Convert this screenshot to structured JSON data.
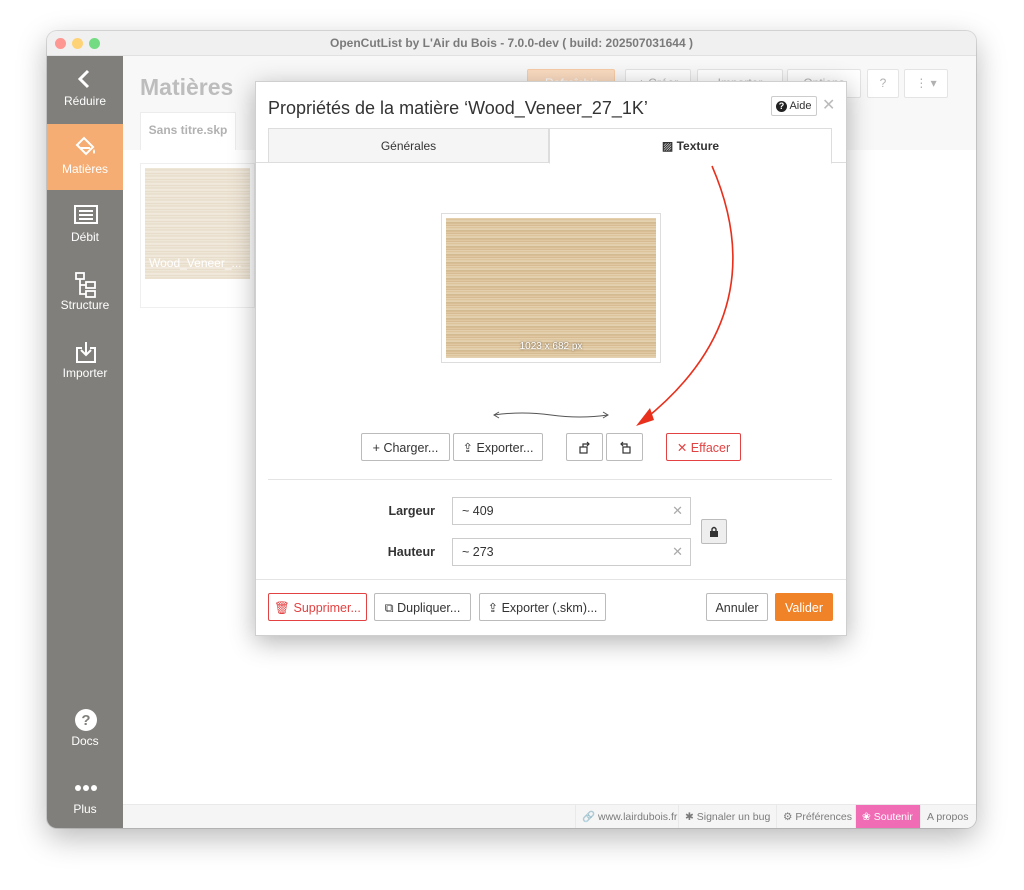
{
  "window": {
    "title": "OpenCutList by L'Air du Bois - 7.0.0-dev ( build: 202507031644 )"
  },
  "sidebar": {
    "items": [
      {
        "label": "Réduire",
        "icon": "chevron-left-icon"
      },
      {
        "label": "Matières",
        "icon": "paint-bucket-icon",
        "active": true
      },
      {
        "label": "Débit",
        "icon": "list-icon"
      },
      {
        "label": "Structure",
        "icon": "tree-icon"
      },
      {
        "label": "Importer",
        "icon": "import-icon"
      }
    ],
    "bottom": [
      {
        "label": "Docs",
        "icon": "question-circle-icon"
      },
      {
        "label": "Plus",
        "icon": "more-dots-icon"
      }
    ]
  },
  "header": {
    "title": "Matières",
    "refresh_label": "Rafraîchir",
    "create_label": "+ Créer",
    "import_label": "Importer",
    "options_label": "Options"
  },
  "file_tab": {
    "label": "Sans titre.skp"
  },
  "card": {
    "name": "Wood_Veneer_..."
  },
  "statusbar": {
    "website": "www.lairdubois.fr",
    "bug": "Signaler un bug",
    "prefs": "Préférences",
    "support": "Soutenir",
    "about": "A propos"
  },
  "modal": {
    "title": "Propriétés de la matière ‘Wood_Veneer_27_1K’",
    "help_label": "Aide",
    "tabs": [
      {
        "label": "Générales",
        "active": false
      },
      {
        "label": "Texture",
        "active": true
      }
    ],
    "texture_size": "1023 x 682 px",
    "buttons": {
      "load": "Charger...",
      "export": "Exporter...",
      "clear": "Effacer"
    },
    "fields": {
      "width_label": "Largeur",
      "width_value": "~ 409",
      "height_label": "Hauteur",
      "height_value": "~ 273"
    },
    "footer": {
      "delete": "Supprimer...",
      "duplicate": "Dupliquer...",
      "export_skm": "Exporter (.skm)...",
      "cancel": "Annuler",
      "validate": "Valider"
    }
  },
  "colors": {
    "sidebar_bg": "#3c3b35",
    "accent": "#f08228",
    "danger": "#e34242",
    "support": "#e91e8c",
    "annotation_arrow": "#e8301c"
  }
}
